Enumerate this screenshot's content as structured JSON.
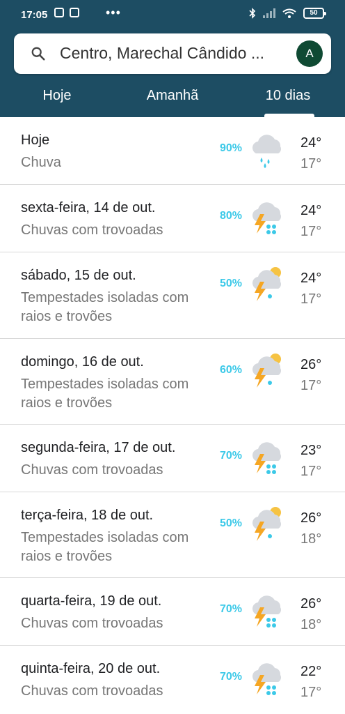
{
  "status_bar": {
    "time": "17:05",
    "dots": "•••",
    "battery": "50"
  },
  "search": {
    "location": "Centro, Marechal Cândido ...",
    "avatar_letter": "A"
  },
  "tabs": [
    {
      "label": "Hoje"
    },
    {
      "label": "Amanhã"
    },
    {
      "label": "10 dias",
      "selected": true
    }
  ],
  "colors": {
    "header": "#1d4d63",
    "precip": "#3cc9e8",
    "avatar": "#0f4a33"
  },
  "days": [
    {
      "day": "Hoje",
      "condition": "Chuva",
      "precip": "90%",
      "high": "24°",
      "low": "17°",
      "icon": "rain-cloud-icon"
    },
    {
      "day": "sexta-feira, 14 de out.",
      "condition": "Chuvas com trovoadas",
      "precip": "80%",
      "high": "24°",
      "low": "17°",
      "icon": "thunderstorm-icon"
    },
    {
      "day": "sábado, 15 de out.",
      "condition": "Tempestades isoladas com raios e trovões",
      "precip": "50%",
      "high": "24°",
      "low": "17°",
      "icon": "isolated-thunderstorm-icon"
    },
    {
      "day": "domingo, 16 de out.",
      "condition": "Tempestades isoladas com raios e trovões",
      "precip": "60%",
      "high": "26°",
      "low": "17°",
      "icon": "isolated-thunderstorm-icon"
    },
    {
      "day": "segunda-feira, 17 de out.",
      "condition": "Chuvas com trovoadas",
      "precip": "70%",
      "high": "23°",
      "low": "17°",
      "icon": "thunderstorm-icon"
    },
    {
      "day": "terça-feira, 18 de out.",
      "condition": "Tempestades isoladas com raios e trovões",
      "precip": "50%",
      "high": "26°",
      "low": "18°",
      "icon": "isolated-thunderstorm-icon"
    },
    {
      "day": "quarta-feira, 19 de out.",
      "condition": "Chuvas com trovoadas",
      "precip": "70%",
      "high": "26°",
      "low": "18°",
      "icon": "thunderstorm-icon"
    },
    {
      "day": "quinta-feira, 20 de out.",
      "condition": "Chuvas com trovoadas",
      "precip": "70%",
      "high": "22°",
      "low": "17°",
      "icon": "thunderstorm-icon"
    }
  ]
}
